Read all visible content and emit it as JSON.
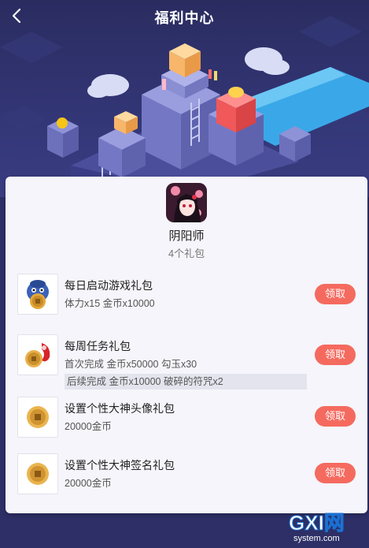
{
  "header": {
    "title": "福利中心"
  },
  "game": {
    "name": "阴阳师",
    "gift_count": "4个礼包"
  },
  "gifts": [
    {
      "title": "每日启动游戏礼包",
      "desc": "体力x15 金币x10000",
      "button": "领取",
      "icon": "blue-creature-coin-icon"
    },
    {
      "title": "每周任务礼包",
      "desc": "首次完成 金币x50000 勾玉x30",
      "desc2": "后续完成 金币x10000 破碎的符咒x2",
      "button": "领取",
      "icon": "coin-and-jade-icon"
    },
    {
      "title": "设置个性大神头像礼包",
      "desc": "20000金币",
      "button": "领取",
      "icon": "gold-coin-icon"
    },
    {
      "title": "设置个性大神签名礼包",
      "desc": "20000金币",
      "button": "领取",
      "icon": "gold-coin-icon"
    }
  ],
  "watermark": {
    "brand": "GXI网",
    "url": "system.com"
  },
  "colors": {
    "accent": "#f56a5f",
    "background": "#2d2f66",
    "card": "#f5f5fb"
  }
}
